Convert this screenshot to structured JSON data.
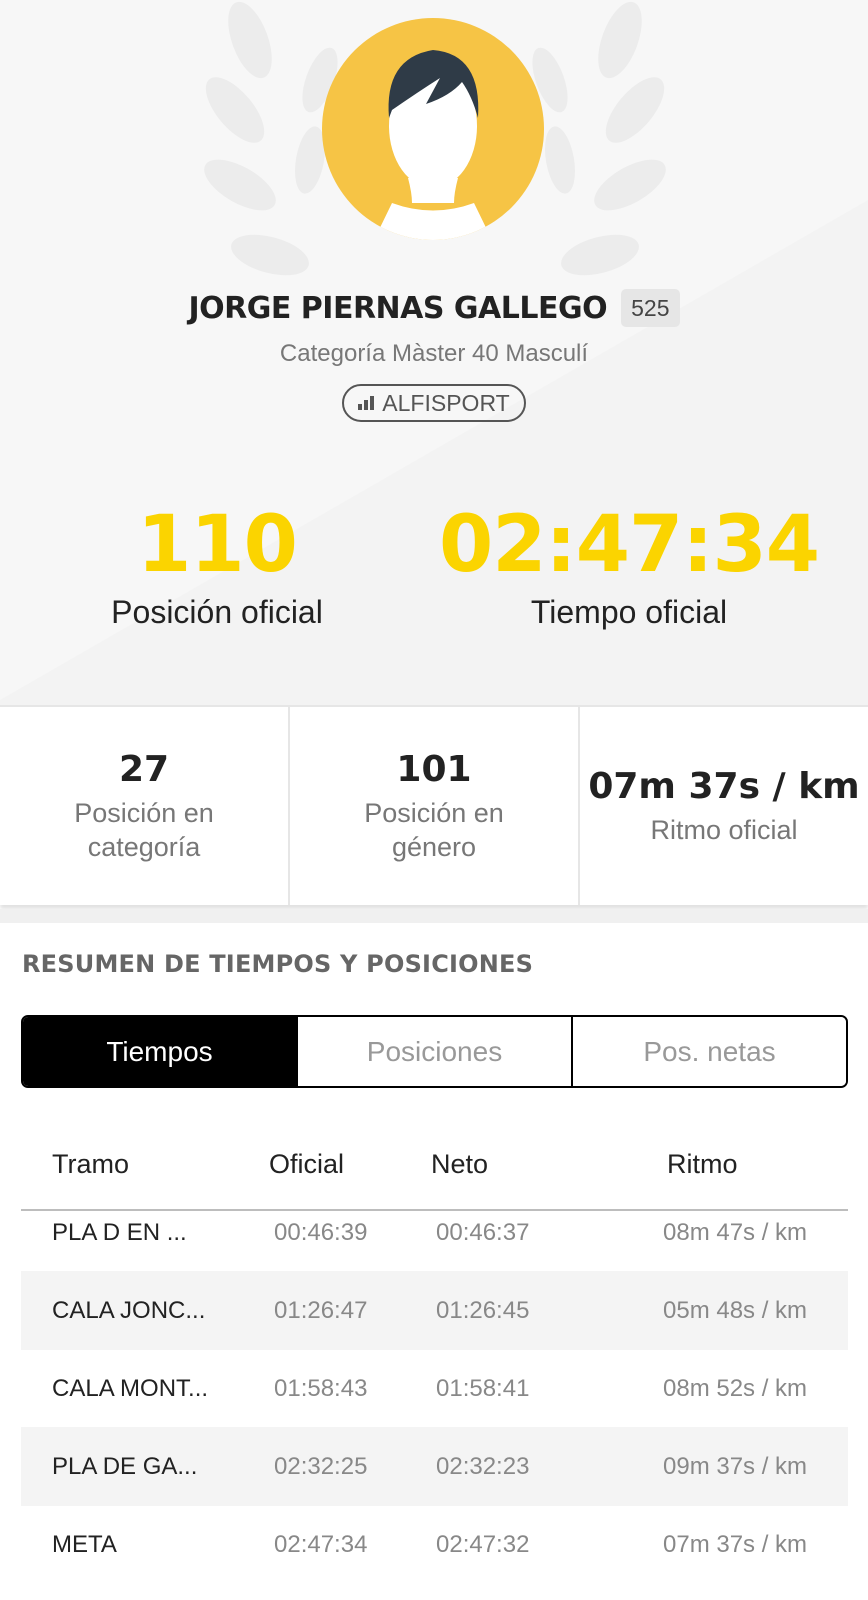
{
  "athlete": {
    "name": "JORGE PIERNAS GALLEGO",
    "bib": "525",
    "category": "Categoría Màster 40 Masculí",
    "team": "ALFISPORT"
  },
  "official": {
    "position_value": "110",
    "position_label": "Posición oficial",
    "time_value": "02:47:34",
    "time_label": "Tiempo oficial"
  },
  "stats": [
    {
      "value": "27",
      "label": "Posición en categoría"
    },
    {
      "value": "101",
      "label": "Posición en género"
    },
    {
      "value": "07m 37s / km",
      "label": "Ritmo oficial"
    }
  ],
  "section": {
    "title": "RESUMEN DE TIEMPOS Y POSICIONES"
  },
  "tabs": [
    "Tiempos",
    "Posiciones",
    "Pos. netas"
  ],
  "active_tab": "Tiempos",
  "table": {
    "headers": [
      "Tramo",
      "Oficial",
      "Neto",
      "Ritmo"
    ],
    "rows": [
      [
        "PLA D EN ...",
        "00:46:39",
        "00:46:37",
        "08m 47s / km"
      ],
      [
        "CALA JONC...",
        "01:26:47",
        "01:26:45",
        "05m 48s / km"
      ],
      [
        "CALA MONT...",
        "01:58:43",
        "01:58:41",
        "08m 52s / km"
      ],
      [
        "PLA DE GA...",
        "02:32:25",
        "02:32:23",
        "09m 37s / km"
      ],
      [
        "META",
        "02:47:34",
        "02:47:32",
        "07m 37s / km"
      ]
    ]
  },
  "colors": {
    "accent_yellow": "#fbd400",
    "avatar_bg": "#f6c445",
    "active_tab_bg": "#000000"
  }
}
